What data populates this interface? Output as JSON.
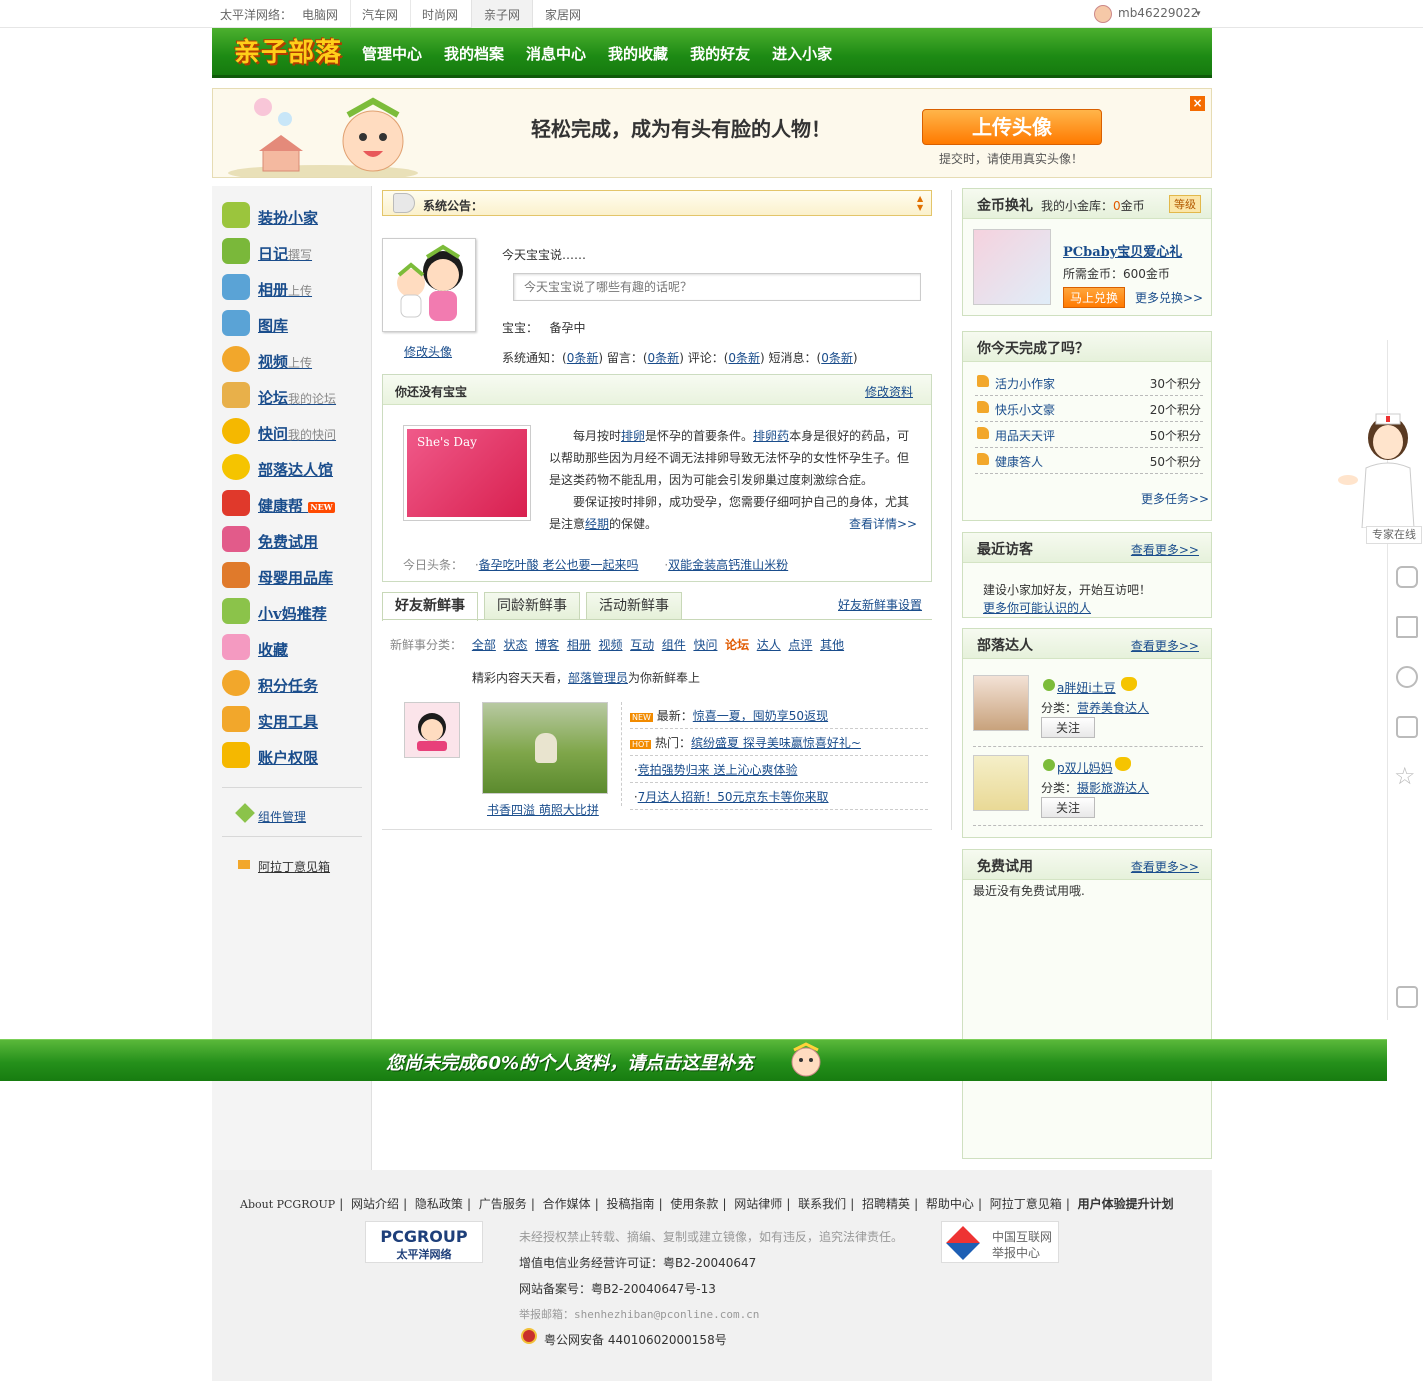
{
  "topbar": {
    "label": "太平洋网络：",
    "sites": [
      "电脑网",
      "汽车网",
      "时尚网",
      "亲子网",
      "家居网"
    ],
    "active_site": "亲子网",
    "username": "mb46229022"
  },
  "header": {
    "logo": "亲子部落",
    "nav": [
      "管理中心",
      "我的档案",
      "消息中心",
      "我的收藏",
      "我的好友",
      "进入小家"
    ]
  },
  "banner": {
    "message": "轻松完成，成为有头有脸的人物！",
    "upload_button": "上传头像",
    "tip": "提交时，请使用真实头像！",
    "close": "×"
  },
  "left_menu": {
    "items": [
      {
        "label": "装扮小家",
        "sub": "",
        "color": "#9bc53d"
      },
      {
        "label": "日记",
        "sub": "撰写",
        "color": "#7ab83a"
      },
      {
        "label": "相册",
        "sub": "上传",
        "color": "#5aa3d6"
      },
      {
        "label": "图库",
        "sub": "",
        "color": "#5aa3d6"
      },
      {
        "label": "视频",
        "sub": "上传",
        "color": "#f2a72b"
      },
      {
        "label": "论坛",
        "sub": "我的论坛",
        "color": "#e8b04a"
      },
      {
        "label": "快问",
        "sub": "我的快问",
        "color": "#f5b800"
      },
      {
        "label": "部落达人馆",
        "sub": "",
        "color": "#f5c400"
      },
      {
        "label": "健康帮",
        "sub": "",
        "color": "#e0392b"
      },
      {
        "label": "免费试用",
        "sub": "",
        "color": "#e25b8a"
      },
      {
        "label": "母婴用品库",
        "sub": "",
        "color": "#e07a2b"
      },
      {
        "label": "小v妈推荐",
        "sub": "",
        "color": "#8bc34a"
      },
      {
        "label": "收藏",
        "sub": "",
        "color": "#f49ac1"
      },
      {
        "label": "积分任务",
        "sub": "",
        "color": "#f2a72b"
      },
      {
        "label": "实用工具",
        "sub": "",
        "color": "#f2a72b"
      },
      {
        "label": "账户权限",
        "sub": "",
        "color": "#f5b800"
      }
    ],
    "new_badge": "NEW",
    "component_manage": "组件管理",
    "feedback": "阿拉丁意见箱"
  },
  "announcement": {
    "label": "系统公告："
  },
  "profile": {
    "edit_avatar": "修改头像",
    "say_title": "今天宝宝说……",
    "say_placeholder": "今天宝宝说了哪些有趣的话呢？",
    "baby_label": "宝宝：",
    "baby_status": "备孕中",
    "notify_line": [
      {
        "label": "系统通知：",
        "value": "0条新"
      },
      {
        "label": "留言：",
        "value": "0条新"
      },
      {
        "label": "评论：",
        "value": "0条新"
      },
      {
        "label": "短消息：",
        "value": "0条新"
      }
    ]
  },
  "baby_box": {
    "title": "你还没有宝宝",
    "edit": "修改资料",
    "product": "She's Day",
    "p1_a": "每月按时",
    "p1_link1": "排卵",
    "p1_b": "是怀孕的首要条件。",
    "p1_link2": "排卵药",
    "p1_c": "本身是很好的药品，可以帮助那些因为月经不调无法排卵导致无法怀孕的女性怀孕生子。但是这类药物不能乱用，因为可能会引发卵巢过度刺激综合症。",
    "p2_a": "要保证按时排卵，成功受孕，您需要仔细呵护自己的身体，尤其是注意",
    "p2_link": "经期",
    "p2_b": "的保健。",
    "more": "查看详情>>",
    "headline_label": "今日头条：",
    "headlines": [
      "备孕吃叶酸 老公也要一起来吗",
      "双能金装高钙淮山米粉"
    ]
  },
  "feed": {
    "tabs": [
      "好友新鲜事",
      "同龄新鲜事",
      "活动新鲜事"
    ],
    "settings": "好友新鲜事设置",
    "cat_label": "新鲜事分类：",
    "categories": [
      "全部",
      "状态",
      "博客",
      "相册",
      "视频",
      "互动",
      "组件",
      "快问",
      "论坛",
      "达人",
      "点评",
      "其他"
    ],
    "active_category": "论坛",
    "promo_a": "精彩内容天天看，",
    "promo_link": "部落管理员",
    "promo_b": "为你新鲜奉上",
    "photo_caption": "书香四溢 萌照大比拼",
    "news": [
      {
        "badge": "NEW",
        "label": "最新：",
        "text": "惊喜一夏，囤奶享50返现"
      },
      {
        "badge": "HOT",
        "label": "热门：",
        "text": "缤纷盛夏 探寻美味赢惊喜好礼~"
      },
      {
        "badge": "",
        "label": "",
        "text": "竞拍强势归来 送上沁心爽体验"
      },
      {
        "badge": "",
        "label": "",
        "text": "7月达人招新！50元京东卡等你来取"
      }
    ]
  },
  "coins": {
    "title": "金币换礼",
    "treasury_a": "我的小金库：",
    "treasury_num": "0",
    "treasury_b": "金币",
    "level": "等级",
    "gift_name": "PCbaby宝贝爱心礼",
    "need_label": "所需金币：",
    "need_value": "600金币",
    "exchange_btn": "马上兑换",
    "more": "更多兑换>>"
  },
  "tasks": {
    "title": "你今天完成了吗？",
    "items": [
      {
        "name": "活力小作家",
        "points": "30个积分"
      },
      {
        "name": "快乐小文豪",
        "points": "20个积分"
      },
      {
        "name": "用品天天评",
        "points": "50个积分"
      },
      {
        "name": "健康答人",
        "points": "50个积分"
      }
    ],
    "more": "更多任务>>"
  },
  "visitors": {
    "title": "最近访客",
    "more": "查看更多>>",
    "text": "建设小家加好友，开始互访吧！",
    "link": "更多你可能认识的人"
  },
  "experts": {
    "title": "部落达人",
    "more": "查看更多>>",
    "cat_label": "分类：",
    "follow": "关注",
    "items": [
      {
        "name": "a胖妞i土豆",
        "category": "营养美食达人"
      },
      {
        "name": "p双儿妈妈",
        "category": "摄影旅游达人"
      }
    ]
  },
  "trial": {
    "title": "免费试用",
    "more": "查看更多>>",
    "empty": "最近没有免费试用哦."
  },
  "promo_bar": "您尚未完成60%的个人资料，请点击这里补充",
  "side": {
    "expert_online": "专家在线"
  },
  "footer": {
    "links": [
      "About PCGROUP",
      "网站介绍",
      "隐私政策",
      "广告服务",
      "合作媒体",
      "投稿指南",
      "使用条款",
      "网站律师",
      "联系我们",
      "招聘精英",
      "帮助中心",
      "阿拉丁意见箱",
      "用户体验提升计划"
    ],
    "pcgroup_logo_a": "PCGROUP",
    "pcgroup_logo_b": "太平洋网络",
    "notice": "未经授权禁止转载、摘编、复制或建立镜像，如有违反，追究法律责任。",
    "license": "增值电信业务经营许可证：粤B2-20040647",
    "icp": "网站备案号：粤B2-20040647号-13",
    "report_email": "举报邮箱：shenhezhiban@pconline.com.cn",
    "police": "粤公网安备 44010602000158号",
    "report_center_a": "中国互联网",
    "report_center_b": "举报中心"
  }
}
